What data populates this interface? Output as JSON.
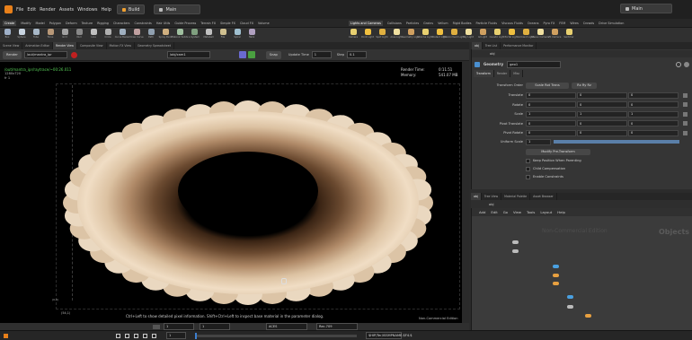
{
  "menubar": {
    "items": [
      "File",
      "Edit",
      "Render",
      "Assets",
      "Windows",
      "Help"
    ],
    "desktop_left": "Build",
    "desktop_center": "Main",
    "desktop_right": "Main"
  },
  "shelf": {
    "tabs": [
      "Create",
      "Modify",
      "Model",
      "Polygon",
      "Deform",
      "Texture",
      "Rigging",
      "Characters",
      "Constraints",
      "Hair Utils",
      "Guide Process",
      "Terrain FX",
      "Simple FX",
      "Cloud FX",
      "Volume"
    ],
    "tools": [
      "Box",
      "Sphere",
      "Tube",
      "Torus",
      "Grid",
      "Null",
      "Line",
      "Circle",
      "Curve Bezier",
      "Draw Curve",
      "Path",
      "Spray Paint",
      "Platonic Solids",
      "L-System",
      "Metaball",
      "File",
      "Spiral",
      "Helix"
    ],
    "tabs_right": [
      "Lights and Cameras",
      "Collisions",
      "Particles",
      "Grains",
      "Vellum",
      "Rigid Bodies",
      "Particle Fluids",
      "Viscous Fluids",
      "Oceans",
      "Pyro FX",
      "FEM",
      "Wires",
      "Crowds",
      "Drive Simulation"
    ],
    "tools_right": [
      "Camera",
      "Point Light",
      "Spot Light",
      "Area Light",
      "Geometry Light",
      "Volume Light",
      "Distant Light",
      "Environment Light",
      "Sky Light",
      "GI Light",
      "Caustic Light",
      "Portal Light",
      "Ambient Light",
      "Stereo Camera",
      "VR Camera",
      "Switcher"
    ]
  },
  "viewer": {
    "tabs": [
      "Scene View",
      "Animation Editor",
      "Render View",
      "Composite View",
      "Motion FX View",
      "Geometry Spreadsheet"
    ],
    "render_button": "Render",
    "rop_path": "/out/mantra_ipr",
    "camera": "/obj/cam1",
    "snap_label": "Snap",
    "update_time_label": "Update Time",
    "update_time_value": "1",
    "step_label": "Step",
    "step_value": "0.1",
    "overlay_tl": "/out/mantra_ipr/raytrace/~00:26.011",
    "overlay_tl2": "1280x720",
    "overlay_tl3": "fr 1",
    "render_time_label": "Render Time:",
    "render_time": "0:11.51",
    "memory_label": "Memory:",
    "memory": "541.07 MB",
    "corner_coord_a": "(0,0)",
    "corner_coord_b": "(54,1)",
    "hint": "Ctrl+Left to show detailed pixel information. Shift+Ctrl+Left to inspect base material in the parameter dialog.",
    "watermark": "Non-Commercial Edition",
    "foot_fields": [
      "1",
      "1",
      "ACES",
      "Rec.709"
    ]
  },
  "params": {
    "tabs_top": [
      "obj",
      "Tree List",
      "Performance Monitor"
    ],
    "path": "obj",
    "node_type": "Geometry",
    "node_name": "geo1",
    "tabs": [
      "Transform",
      "Render",
      "Misc"
    ],
    "transform_order_label": "Transform Order",
    "transform_order": "Scale Rot Trans",
    "rot_order": "Rx Ry Rz",
    "rows": [
      {
        "label": "Translate",
        "v": [
          "0",
          "0",
          "0"
        ]
      },
      {
        "label": "Rotate",
        "v": [
          "0",
          "0",
          "0"
        ]
      },
      {
        "label": "Scale",
        "v": [
          "1",
          "1",
          "1"
        ]
      },
      {
        "label": "Pivot Translate",
        "v": [
          "0",
          "0",
          "0"
        ]
      },
      {
        "label": "Pivot Rotate",
        "v": [
          "0",
          "0",
          "0"
        ]
      }
    ],
    "uniform_scale_label": "Uniform Scale",
    "uniform_scale": "1",
    "modify_pre": "Modify Pre-Transform",
    "keep_pos": "Keep Position When Parenting",
    "child_comp": "Child Compensation",
    "enable_constraints": "Enable Constraints"
  },
  "network": {
    "tabs": [
      "obj",
      "Tree View",
      "Material Palette",
      "Asset Browser"
    ],
    "path": "obj",
    "menu": [
      "Add",
      "Edit",
      "Go",
      "View",
      "Tools",
      "Layout",
      "Help"
    ],
    "watermark": "Non-Commercial Edition",
    "context_label": "Objects"
  },
  "playbar": {
    "frame": "1",
    "frame_field": "1",
    "end": "240",
    "path": "$HIP/Ter/ISSMPNAME.$F4.$"
  },
  "colors": {
    "accent": "#e8801a",
    "viewport_bg": "#000000",
    "node_orange": "#e8a040",
    "node_blue": "#4aa0e0"
  }
}
